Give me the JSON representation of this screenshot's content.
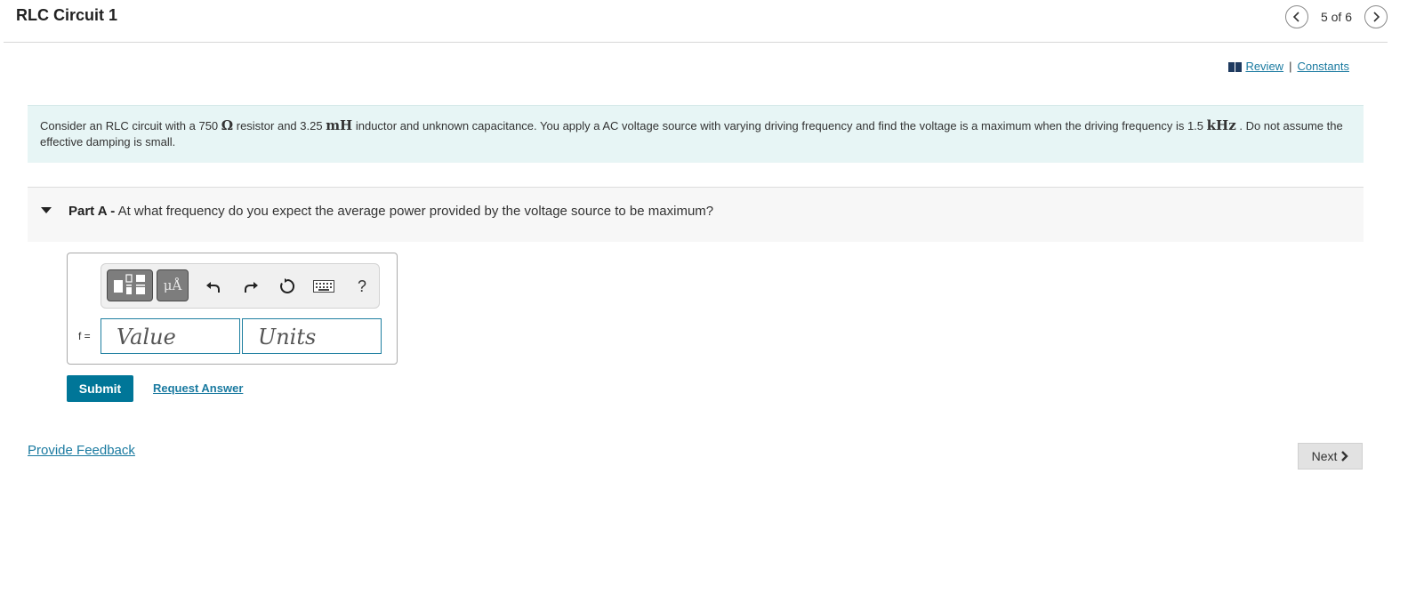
{
  "header": {
    "title": "RLC Circuit 1",
    "page_info": "5 of 6"
  },
  "links": {
    "review": "Review",
    "separator": "|",
    "constants": "Constants"
  },
  "problem": {
    "text_1": "Consider an RLC circuit with a 750 ",
    "unit_ohm": "Ω",
    "text_2": " resistor and 3.25 ",
    "unit_mh": "mH",
    "text_3": " inductor and unknown capacitance. You apply a AC voltage source with varying driving frequency and find the voltage is a maximum when the driving frequency is 1.5 ",
    "unit_khz": "kHz",
    "text_4": " . Do not assume the effective damping is small."
  },
  "part": {
    "label": "Part A -",
    "question": " At what frequency do you expect the average power provided by the voltage source to be maximum?"
  },
  "answer": {
    "variable_label": "f =",
    "value_placeholder": "Value",
    "units_placeholder": "Units",
    "units_button": "μÅ",
    "help": "?"
  },
  "actions": {
    "submit": "Submit",
    "request_answer": "Request Answer",
    "provide_feedback": "Provide Feedback",
    "next": "Next"
  },
  "colors": {
    "accent": "#007698",
    "problem_bg": "#e7f5f5",
    "link": "#1a7aa0"
  },
  "icons": [
    "chevron-left-icon",
    "chevron-right-icon",
    "book-icon",
    "triangle-down-icon",
    "templates-icon",
    "undo-icon",
    "redo-icon",
    "reset-icon",
    "keyboard-icon"
  ]
}
